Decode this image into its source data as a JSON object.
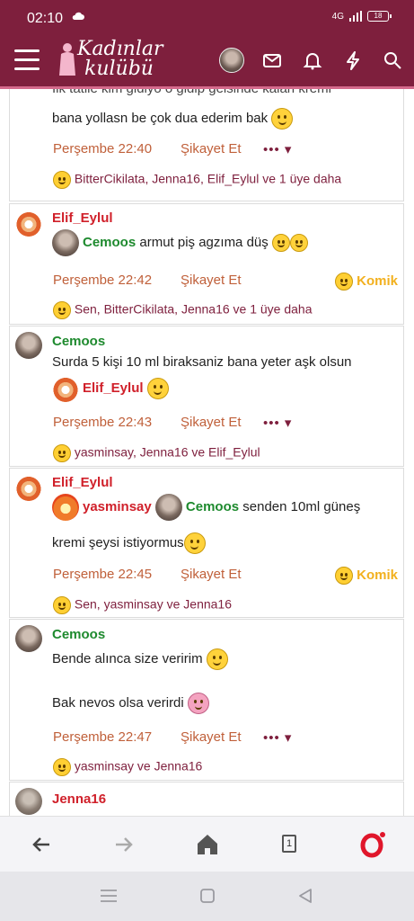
{
  "status_bar": {
    "time": "02:10",
    "network": "4G",
    "battery": "18"
  },
  "header": {
    "logo_line1": "Kadınlar",
    "logo_line2": "kulübü"
  },
  "posts": [
    {
      "partial_text": "İlk tatile kim gidiyo o gidip gelsinde kalan kremi",
      "text": "bana yollasn be çok dua ederim bak",
      "date": "Perşembe 22:40",
      "report": "Şikayet Et",
      "more": "•••",
      "likes": "BitterCikilata, Jenna16, Elif_Eylul ve 1 üye daha"
    },
    {
      "author": "Elif_Eylul",
      "mention": "Cemoos",
      "text": "armut piş agzıma düş",
      "date": "Perşembe 22:42",
      "report": "Şikayet Et",
      "reaction": "Komik",
      "likes": "Sen, BitterCikilata, Jenna16 ve 1 üye daha"
    },
    {
      "author": "Cemoos",
      "text": "Surda 5 kişi 10 ml biraksaniz bana yeter aşk olsun",
      "mention": "Elif_Eylul",
      "date": "Perşembe 22:43",
      "report": "Şikayet Et",
      "more": "•••",
      "likes": "yasminsay, Jenna16 ve Elif_Eylul"
    },
    {
      "author": "Elif_Eylul",
      "mention1": "yasminsay",
      "mention2": "Cemoos",
      "text_line1": "senden 10ml güneş",
      "text_line2": "kremi şeysi istiyormus",
      "date": "Perşembe 22:45",
      "report": "Şikayet Et",
      "reaction": "Komik",
      "likes": "Sen, yasminsay ve Jenna16"
    },
    {
      "author": "Cemoos",
      "text_line1": "Bende alınca size veririm",
      "text_line2": "Bak nevos olsa verirdi",
      "date": "Perşembe 22:47",
      "report": "Şikayet Et",
      "more": "•••",
      "likes": "yasminsay ve Jenna16"
    },
    {
      "author": "Jenna16"
    }
  ],
  "browser": {
    "tab_count": "1"
  },
  "colors": {
    "brand": "#7e1f3d",
    "username_red": "#d0202a",
    "username_green": "#1e8a2e",
    "date": "#c0603a",
    "reaction": "#f2b01e"
  },
  "icons": [
    "hamburger-icon",
    "mail-icon",
    "bell-icon",
    "lightning-icon",
    "search-icon",
    "back-icon",
    "forward-icon",
    "home-icon",
    "tabs-icon",
    "opera-icon"
  ]
}
